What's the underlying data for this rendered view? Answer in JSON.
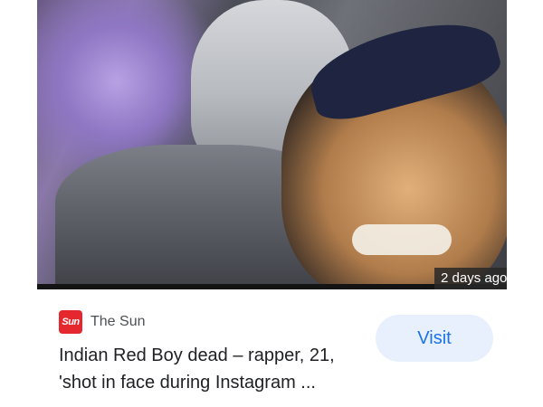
{
  "card": {
    "thumbnail": {
      "description_icon": "video-thumbnail",
      "time_badge": "2 days ago"
    },
    "source": {
      "logo_text": "Sun",
      "name": "The Sun",
      "logo_color": "#e4282e"
    },
    "headline": {
      "line1": "Indian Red Boy dead – rapper, 21,",
      "line2": "'shot in face during Instagram ..."
    },
    "visit_button": {
      "label": "Visit",
      "text_color": "#1a73e8",
      "bg_color": "#e8f0fe"
    }
  }
}
